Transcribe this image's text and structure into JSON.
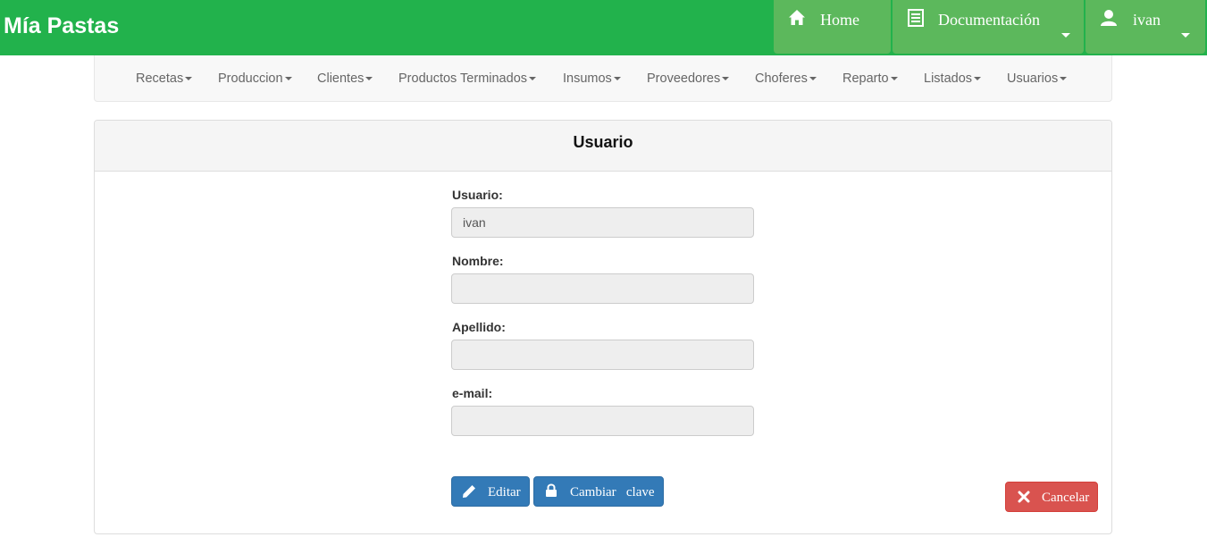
{
  "brand": "Mía Pastas",
  "topnav": {
    "home": "Home",
    "docs": "Documentación",
    "user": "ivan"
  },
  "menu": [
    "Recetas",
    "Produccion",
    "Clientes",
    "Productos Terminados",
    "Insumos",
    "Proveedores",
    "Choferes",
    "Reparto",
    "Listados",
    "Usuarios"
  ],
  "panel": {
    "title": "Usuario"
  },
  "form": {
    "usuario_label": "Usuario:",
    "usuario_value": "ivan",
    "nombre_label": "Nombre:",
    "nombre_value": "",
    "apellido_label": "Apellido:",
    "apellido_value": "",
    "email_label": "e-mail:",
    "email_value": ""
  },
  "buttons": {
    "editar": "Editar",
    "cambiar_clave": "Cambiar   clave",
    "cancelar": "Cancelar"
  },
  "colors": {
    "brand_green": "#22b24c",
    "topbtn_green": "#5cb85c",
    "primary_blue": "#337ab7",
    "danger_red": "#d9534f"
  },
  "icons": {
    "home": "home-icon",
    "docs": "document-list-icon",
    "user": "user-icon",
    "edit": "pencil-icon",
    "lock": "lock-icon",
    "cancel": "close-icon"
  }
}
